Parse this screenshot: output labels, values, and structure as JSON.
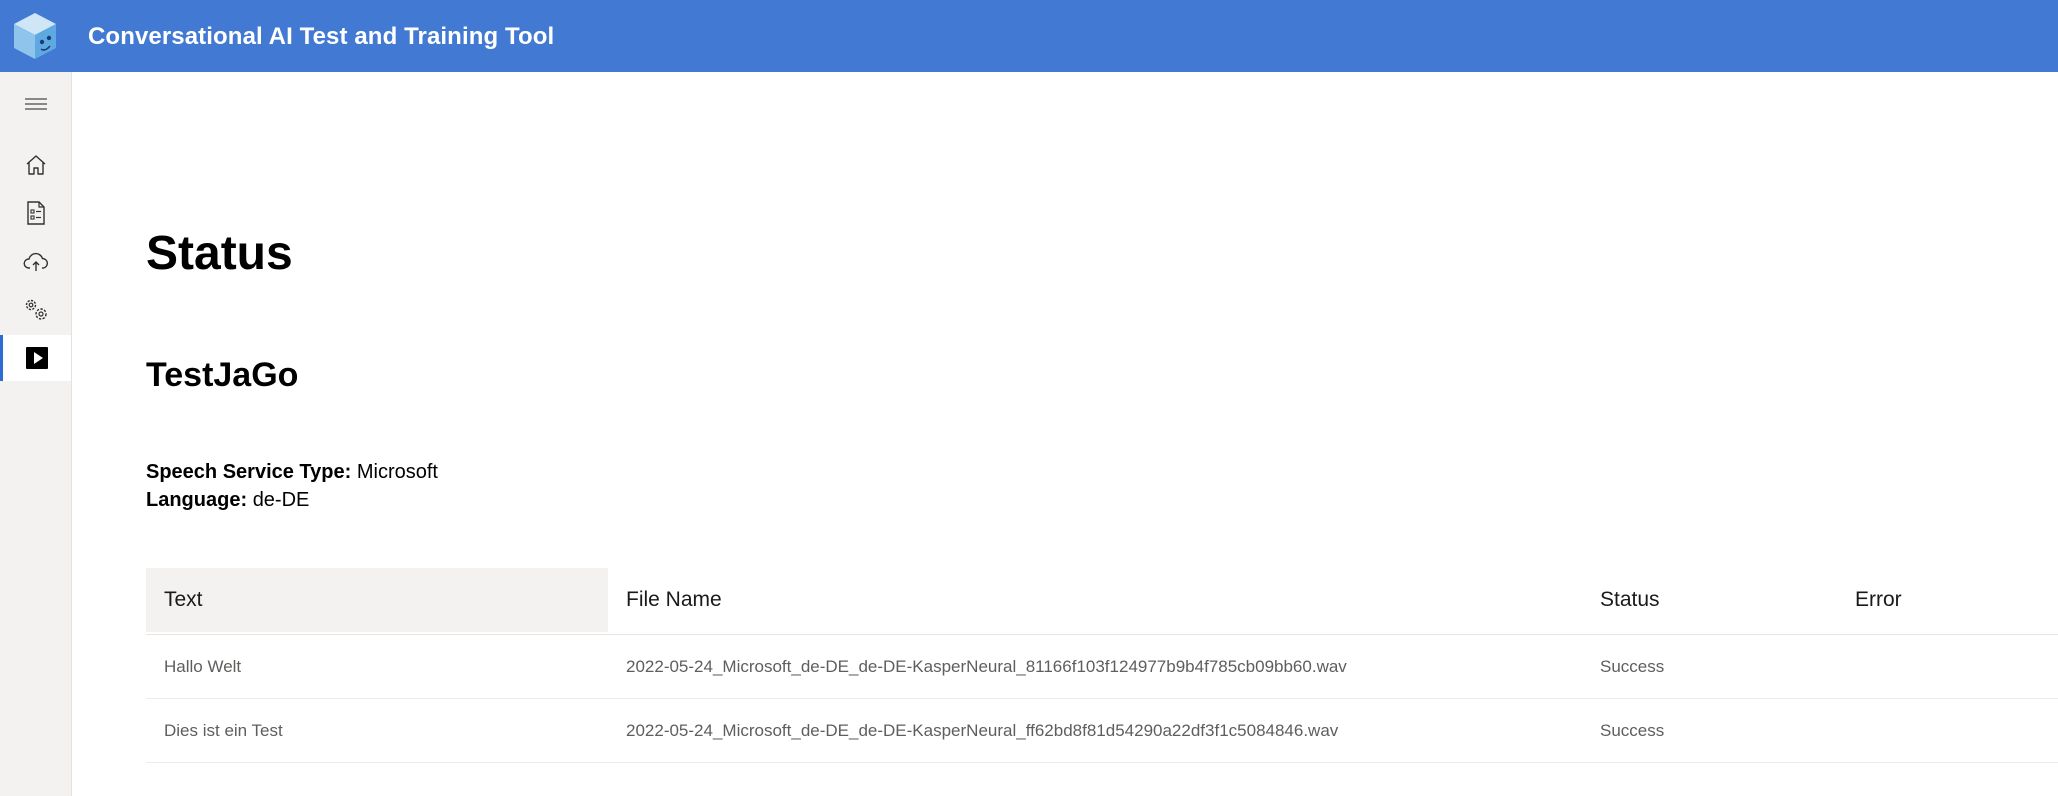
{
  "app": {
    "title": "Conversational AI Test and Training Tool"
  },
  "sidebar": {
    "items": [
      {
        "icon": "hamburger-menu-icon"
      },
      {
        "icon": "home-icon"
      },
      {
        "icon": "test-list-icon"
      },
      {
        "icon": "cloud-upload-icon"
      },
      {
        "icon": "settings-icon"
      },
      {
        "icon": "play-icon",
        "active": true
      }
    ]
  },
  "page": {
    "title": "Status",
    "test_name": "TestJaGo",
    "speech_service_label": "Speech Service Type:",
    "speech_service_value": "Microsoft",
    "language_label": "Language:",
    "language_value": "de-DE"
  },
  "table": {
    "columns": [
      "Text",
      "File Name",
      "Status",
      "Error"
    ],
    "rows": [
      {
        "text": "Hallo Welt",
        "file_name": "2022-05-24_Microsoft_de-DE_de-DE-KasperNeural_81166f103f124977b9b4f785cb09bb60.wav",
        "status": "Success",
        "error": ""
      },
      {
        "text": "Dies ist ein Test",
        "file_name": "2022-05-24_Microsoft_de-DE_de-DE-KasperNeural_ff62bd8f81d54290a22df3f1c5084846.wav",
        "status": "Success",
        "error": ""
      }
    ]
  },
  "colors": {
    "header": "#4179d3",
    "sidebar": "#f3f2f1",
    "accent": "#2d6cd2"
  }
}
